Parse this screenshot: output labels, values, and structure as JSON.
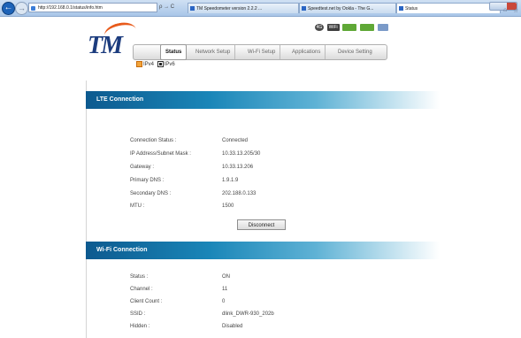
{
  "browser": {
    "address": "http://192.168.0.1/status/info.htm",
    "address_tools": "ρ → C",
    "tabs": [
      {
        "label": "TM Speedometer version 2.2.2 ..."
      },
      {
        "label": "Speedtest.net by Ookla - The G..."
      },
      {
        "label": "Status"
      }
    ],
    "tab_close": "×"
  },
  "brand": {
    "logo_text": "TM"
  },
  "status_icons": {
    "lte": "4G",
    "wifi": "WiFi",
    "signal": "",
    "battery": ""
  },
  "nav": {
    "tabs": [
      {
        "label": "Status"
      },
      {
        "label": "Network Setup"
      },
      {
        "label": "Wi-Fi Setup"
      },
      {
        "label": "Applications"
      },
      {
        "label": "Device Setting"
      }
    ]
  },
  "ip_version": {
    "options": [
      "IPv4",
      "IPv6"
    ],
    "selected": "IPv4"
  },
  "lte": {
    "title": "LTE Connection",
    "rows": [
      {
        "label": "Connection Status :",
        "value": "Connected"
      },
      {
        "label": "IP Address/Subnet Mask :",
        "value": "10.33.13.205/30"
      },
      {
        "label": "Gateway :",
        "value": "10.33.13.206"
      },
      {
        "label": "Primary DNS :",
        "value": "1.9.1.9"
      },
      {
        "label": "Secondary DNS :",
        "value": "202.188.0.133"
      },
      {
        "label": "MTU :",
        "value": "1500"
      }
    ],
    "disconnect_label": "Disconnect"
  },
  "wifi": {
    "title": "Wi-Fi Connection",
    "rows": [
      {
        "label": "Status :",
        "value": "ON"
      },
      {
        "label": "Channel :",
        "value": "11"
      },
      {
        "label": "Client Count :",
        "value": "0"
      },
      {
        "label": "SSID :",
        "value": "dlink_DWR-930_202b"
      },
      {
        "label": "Hidden :",
        "value": "Disabled"
      }
    ]
  }
}
